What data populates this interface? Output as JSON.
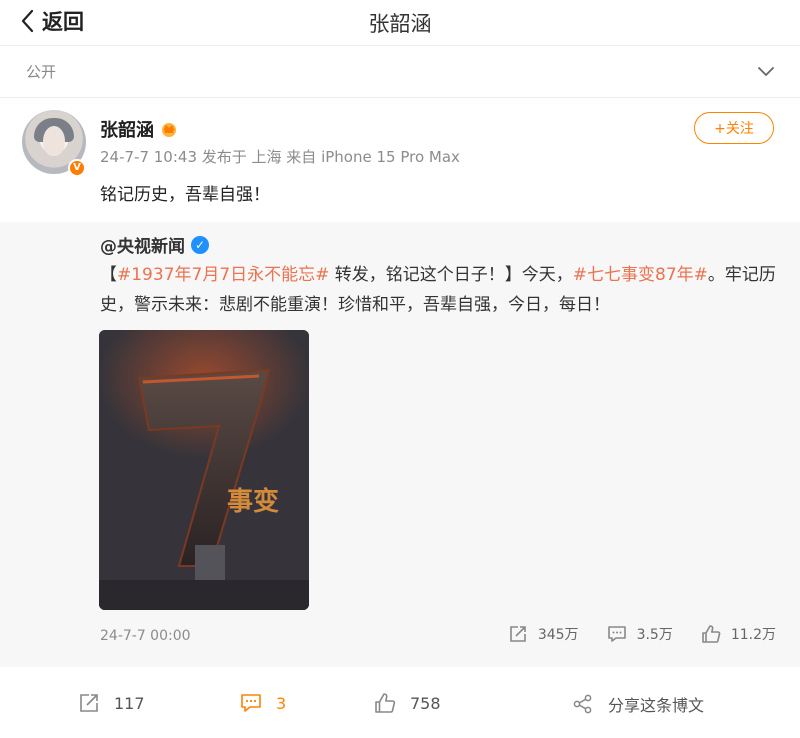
{
  "header": {
    "back_label": "返回",
    "title": "张韶涵"
  },
  "visibility": {
    "label": "公开"
  },
  "post": {
    "author": "张韶涵",
    "verified_badge": "V",
    "meta": "24-7-7 10:43 发布于 上海 来自 iPhone 15 Pro Max",
    "follow_label": "+关注",
    "text": "铭记历史，吾辈自强！"
  },
  "repost": {
    "author": "@央视新闻",
    "text_parts": [
      "【",
      "#1937年7月7日永不能忘#",
      " 转发，铭记这个日子！】今天，",
      "#七七事变87年#",
      "。牢记历史，警示未来：悲剧不能重演！珍惜和平，吾辈自强，今日，每日！"
    ],
    "image_text": {
      "numeral": "7",
      "chars": "事变"
    },
    "date": "24-7-7 00:00",
    "stats": {
      "reposts": "345万",
      "comments": "3.5万",
      "likes": "11.2万"
    }
  },
  "actions": {
    "reposts": "117",
    "comments": "3",
    "likes": "758",
    "share_label": "分享这条博文"
  },
  "colors": {
    "accent": "#ff8200",
    "tag": "#eb7350",
    "repost_bg": "#f7f7f7"
  }
}
